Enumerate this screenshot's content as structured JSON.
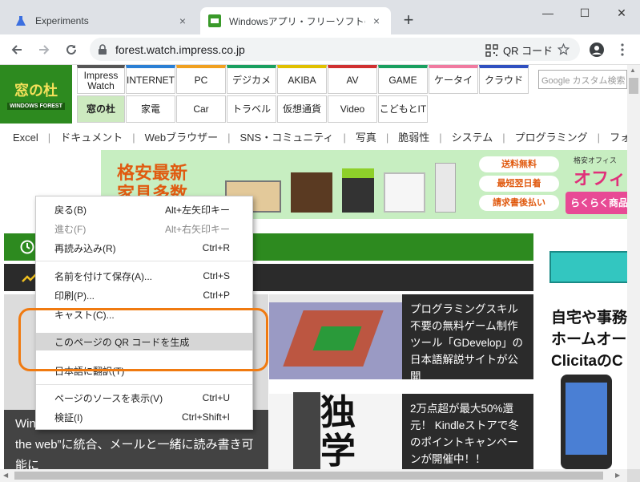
{
  "browser": {
    "tabs": [
      {
        "title": "Experiments",
        "close": "×"
      },
      {
        "title": "Windowsアプリ・フリーソフトのおすすめ",
        "close": "×"
      }
    ],
    "new_tab": "+",
    "window_controls": {
      "minimize": "—",
      "maximize": "☐",
      "close": "✕"
    },
    "url": "forest.watch.impress.co.jp",
    "qr_label": "QR コード"
  },
  "site": {
    "logo_text": "窓の杜",
    "logo_sub": "WINDOWS FOREST",
    "nav_row1": [
      "Impress Watch",
      "INTERNET",
      "PC",
      "デジカメ",
      "AKIBA",
      "AV",
      "GAME",
      "ケータイ",
      "クラウド"
    ],
    "nav_row2": [
      "窓の杜",
      "家電",
      "Car",
      "トラベル",
      "仮想通貨",
      "Video",
      "こどもとIT"
    ],
    "nav_colors": [
      "#555555",
      "#2a7fd4",
      "#f0a020",
      "#1aa060",
      "#e0c000",
      "#d03030",
      "#1aa060",
      "#f07aa0",
      "#3050c0"
    ],
    "search_placeholder": "Google カスタム検索",
    "subnav": [
      "Excel",
      "|",
      "ドキュメント",
      "|",
      "Webブラウザー",
      "|",
      "SNS・コミュニティ",
      "|",
      "写真",
      "|",
      "脆弱性",
      "|",
      "システム",
      "|",
      "プログラミング",
      "|",
      "フォン"
    ],
    "banner": {
      "headline1": "格安最新",
      "headline2": "家具多数",
      "btn1": "送料無料",
      "btn2": "最短翌日着",
      "btn3": "請求書後払い",
      "right_top": "格安オフィス",
      "right_big": "オフィ",
      "right_btn": "らくらく商品"
    },
    "article_left": "Windows 10標準の付箋アプリが“Outlook on the web”に統合、メールと一緒に読み書き可能に",
    "articles": [
      "プログラミングスキル不要の無料ゲーム制作ツール「GDevelop」の日本語解説サイトが公開",
      "2万点超が最大50%還元！ Kindleストアで冬のポイントキャンペーンが開催中！！"
    ],
    "thumb_text": "独学",
    "ad_right": [
      "自宅や事務",
      "ホームオー",
      "ClicitaのC"
    ]
  },
  "context_menu": {
    "items": [
      {
        "label": "戻る(B)",
        "shortcut": "Alt+左矢印キー",
        "disabled": false
      },
      {
        "label": "進む(F)",
        "shortcut": "Alt+右矢印キー",
        "disabled": true
      },
      {
        "label": "再読み込み(R)",
        "shortcut": "Ctrl+R",
        "disabled": false
      },
      {
        "label": "名前を付けて保存(A)...",
        "shortcut": "Ctrl+S",
        "disabled": false
      },
      {
        "label": "印刷(P)...",
        "shortcut": "Ctrl+P",
        "disabled": false
      },
      {
        "label": "キャスト(C)...",
        "shortcut": "",
        "disabled": false
      },
      {
        "label": "このページの QR コードを生成",
        "shortcut": "",
        "disabled": false
      },
      {
        "label": "日本語に翻訳(T)",
        "shortcut": "",
        "disabled": false
      },
      {
        "label": "ページのソースを表示(V)",
        "shortcut": "Ctrl+U",
        "disabled": false
      },
      {
        "label": "検証(I)",
        "shortcut": "Ctrl+Shift+I",
        "disabled": false
      }
    ]
  },
  "highlight_color": "#f07a10"
}
